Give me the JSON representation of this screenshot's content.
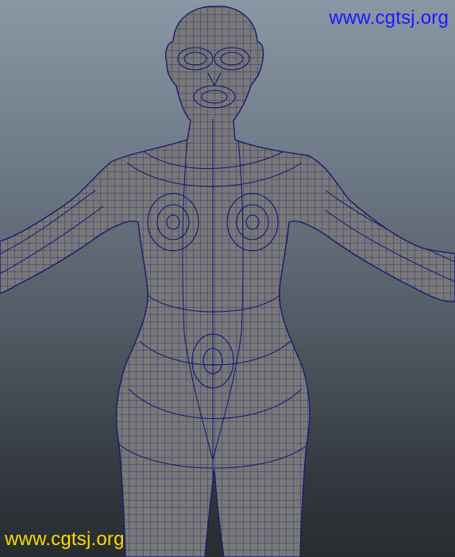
{
  "viewport": {
    "subject": "wireframe-female-body-model",
    "background_top": "#8a97a4",
    "background_bottom": "#272c31",
    "mesh_fill": "#787878",
    "wire_color": "#141473"
  },
  "watermark_top": {
    "text": "www.cgtsj.org",
    "color": "#1a1aff"
  },
  "watermark_bottom": {
    "text": "www.cgtsj.org",
    "color": "#ffd800"
  }
}
